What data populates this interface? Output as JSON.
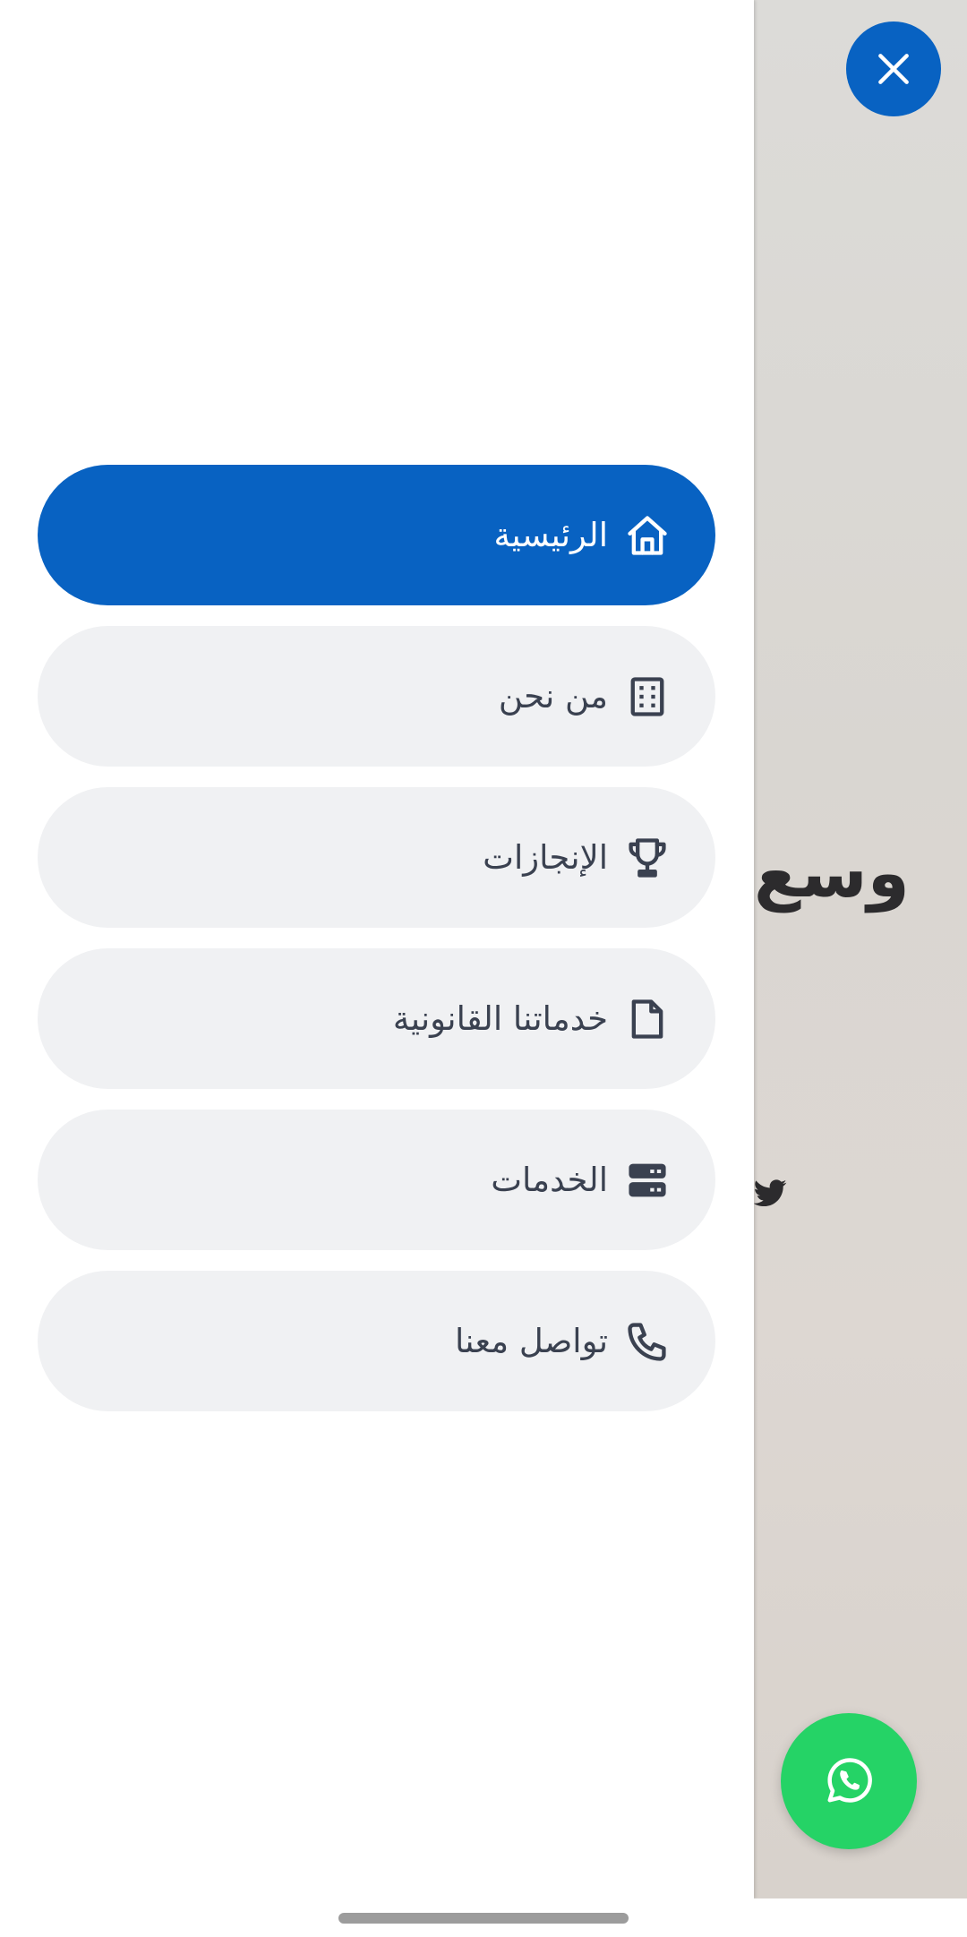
{
  "background": {
    "heading_fragment": "وسع"
  },
  "menu": {
    "items": [
      {
        "label": "الرئيسية",
        "icon": "home-icon",
        "active": true
      },
      {
        "label": "من نحن",
        "icon": "building-icon",
        "active": false
      },
      {
        "label": "الإنجازات",
        "icon": "trophy-icon",
        "active": false
      },
      {
        "label": "خدماتنا القانونية",
        "icon": "document-icon",
        "active": false
      },
      {
        "label": "الخدمات",
        "icon": "server-icon",
        "active": false
      },
      {
        "label": "تواصل معنا",
        "icon": "phone-icon",
        "active": false
      }
    ]
  },
  "buttons": {
    "close_icon": "close-icon",
    "whatsapp_icon": "whatsapp-icon"
  },
  "colors": {
    "primary": "#0862c2",
    "menu_bg": "#f0f1f3",
    "menu_text": "#3a4150",
    "whatsapp": "#25d366"
  }
}
